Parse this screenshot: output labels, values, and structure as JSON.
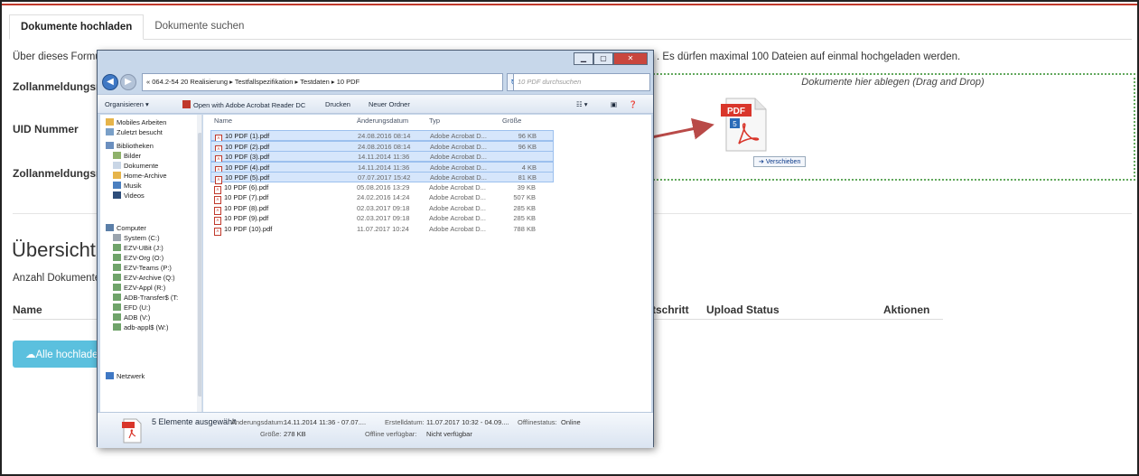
{
  "tabs": [
    {
      "label": "Dokumente hochladen"
    },
    {
      "label": "Dokumente suchen"
    }
  ],
  "page": {
    "intro_left": "Über dieses Formul",
    "intro_right": ". Es dürfen maximal 100 Dateien auf einmal hochgeladen werden.",
    "field1_label": "Zollanmeldungsnur",
    "field2_label": "UID Nummer",
    "field3_label": "Zollanmeldungsnur",
    "dropzone_text": "Dokumente hier ablegen (Drag and Drop)",
    "move_badge": "Verschieben",
    "overview_title": "Übersicht d",
    "count_label": "Anzahl Dokumente",
    "table_headers": {
      "name": "Name",
      "schritt": "tschritt",
      "upload_status": "Upload Status",
      "aktionen": "Aktionen"
    },
    "upload_all_button": "Alle hochladen",
    "arrow_color": "#b94a48",
    "accent_color": "#c0392b",
    "dropzone_border_color": "#62a85d",
    "button_color": "#5bc0de"
  },
  "dialog": {
    "breadcrumb": "« 064.2-54 20 Realisierung ▸ Testfallspezifikation ▸ Testdaten ▸ 10 PDF",
    "search_placeholder": "10 PDF durchsuchen",
    "toolbar": {
      "organize": "Organisieren ▾",
      "open_with": "Open with Adobe Acrobat Reader DC",
      "print": "Drucken",
      "new_folder": "Neuer Ordner"
    },
    "nav_items": [
      {
        "label": "Mobiles Arbeiten",
        "icon": "folder-icon"
      },
      {
        "label": "Zuletzt besucht",
        "icon": "recent-icon"
      },
      {
        "label": "Bibliotheken",
        "icon": "library-icon"
      },
      {
        "label": "Bilder",
        "icon": "pictures-icon"
      },
      {
        "label": "Dokumente",
        "icon": "documents-icon"
      },
      {
        "label": "Home-Archive",
        "icon": "folder-icon"
      },
      {
        "label": "Musik",
        "icon": "music-icon"
      },
      {
        "label": "Videos",
        "icon": "video-icon"
      },
      {
        "label": "Computer",
        "icon": "computer-icon"
      },
      {
        "label": "System (C:)",
        "icon": "drive-icon"
      },
      {
        "label": "EZV-UBit (J:)",
        "icon": "network-drive-icon"
      },
      {
        "label": "EZV-Org (O:)",
        "icon": "network-drive-icon"
      },
      {
        "label": "EZV-Teams (P:)",
        "icon": "network-drive-icon"
      },
      {
        "label": "EZV-Archive (Q:)",
        "icon": "network-drive-icon"
      },
      {
        "label": "EZV-Appl (R:)",
        "icon": "network-drive-icon"
      },
      {
        "label": "ADB-Transfer$ (T:",
        "icon": "network-drive-icon"
      },
      {
        "label": "EFD (U:)",
        "icon": "network-drive-icon"
      },
      {
        "label": "ADB (V:)",
        "icon": "network-drive-icon"
      },
      {
        "label": "adb-appl$ (W:)",
        "icon": "network-drive-icon"
      },
      {
        "label": "Netzwerk",
        "icon": "network-icon"
      }
    ],
    "columns": {
      "name": "Name",
      "date": "Änderungsdatum",
      "type": "Typ",
      "size": "Größe"
    },
    "files": [
      {
        "name": "10 PDF (1).pdf",
        "date": "24.08.2016 08:14",
        "type": "Adobe Acrobat D...",
        "size": "96 KB",
        "selected": true
      },
      {
        "name": "10 PDF (2).pdf",
        "date": "24.08.2016 08:14",
        "type": "Adobe Acrobat D...",
        "size": "96 KB",
        "selected": true
      },
      {
        "name": "10 PDF (3).pdf",
        "date": "14.11.2014 11:36",
        "type": "Adobe Acrobat D...",
        "size": "",
        "selected": true
      },
      {
        "name": "10 PDF (4).pdf",
        "date": "14.11.2014 11:36",
        "type": "Adobe Acrobat D...",
        "size": "4 KB",
        "selected": true
      },
      {
        "name": "10 PDF (5).pdf",
        "date": "07.07.2017 15:42",
        "type": "Adobe Acrobat D...",
        "size": "81 KB",
        "selected": true
      },
      {
        "name": "10 PDF (6).pdf",
        "date": "05.08.2016 13:29",
        "type": "Adobe Acrobat D...",
        "size": "39 KB",
        "selected": false
      },
      {
        "name": "10 PDF (7).pdf",
        "date": "24.02.2016 14:24",
        "type": "Adobe Acrobat D...",
        "size": "507 KB",
        "selected": false
      },
      {
        "name": "10 PDF (8).pdf",
        "date": "02.03.2017 09:18",
        "type": "Adobe Acrobat D...",
        "size": "285 KB",
        "selected": false
      },
      {
        "name": "10 PDF (9).pdf",
        "date": "02.03.2017 09:18",
        "type": "Adobe Acrobat D...",
        "size": "285 KB",
        "selected": false
      },
      {
        "name": "10 PDF (10).pdf",
        "date": "11.07.2017 10:24",
        "type": "Adobe Acrobat D...",
        "size": "788 KB",
        "selected": false
      }
    ],
    "details": {
      "selected_count": "5 Elemente ausgewählt",
      "modified_label": "Änderungsdatum:",
      "modified_value": "14.11.2014 11:36 - 07.07....",
      "created_label": "Erstelldatum:",
      "created_value": "11.07.2017 10:32 - 04.09....",
      "offline_status_label": "Offlinestatus:",
      "offline_status_value": "Online",
      "size_label": "Größe:",
      "size_value": "278 KB",
      "offline_avail_label": "Offline verfügbar:",
      "offline_avail_value": "Nicht verfügbar"
    }
  }
}
